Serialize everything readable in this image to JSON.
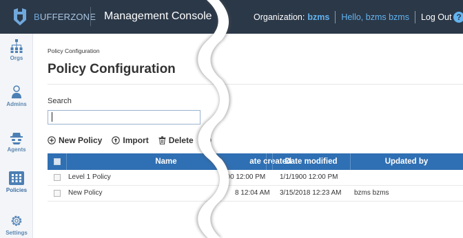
{
  "header": {
    "brand_prefix": "B",
    "brand_rest": "UFFERZONE",
    "console_title": "Management Console",
    "org_label": "Organization:",
    "org_value": "bzms",
    "hello": "Hello, bzms bzms",
    "logout": "Log Out",
    "help": "?"
  },
  "sidebar": {
    "items": [
      {
        "label": "Orgs",
        "icon": "org-chart-icon"
      },
      {
        "label": "Admins",
        "icon": "admin-user-icon"
      },
      {
        "label": "Agents",
        "icon": "agent-spy-icon"
      },
      {
        "label": "Policies",
        "icon": "policies-grid-icon"
      },
      {
        "label": "Settings",
        "icon": "gear-icon"
      }
    ]
  },
  "breadcrumb": "Policy Configuration",
  "page_title": "Policy Configuration",
  "search": {
    "label": "Search",
    "value": "",
    "placeholder": ""
  },
  "toolbar": {
    "new_policy": "New Policy",
    "import": "Import",
    "delete": "Delete"
  },
  "table": {
    "columns": {
      "name": "Name",
      "date_created": "ate created",
      "date_modified": "Date modified",
      "updated_by": "Updated by"
    },
    "rows": [
      {
        "name": "Level 1 Policy",
        "date_created": "900 12:00 PM",
        "date_modified": "1/1/1900 12:00 PM",
        "updated_by": ""
      },
      {
        "name": "New Policy",
        "date_created": "8 12:04 AM",
        "date_modified": "3/15/2018 12:23 AM",
        "updated_by": "bzms bzms"
      }
    ]
  },
  "colors": {
    "topbar": "#2b3848",
    "accent": "#63b4f0",
    "table_header": "#2f6fb3",
    "sidebar_label": "#5b86b0"
  }
}
